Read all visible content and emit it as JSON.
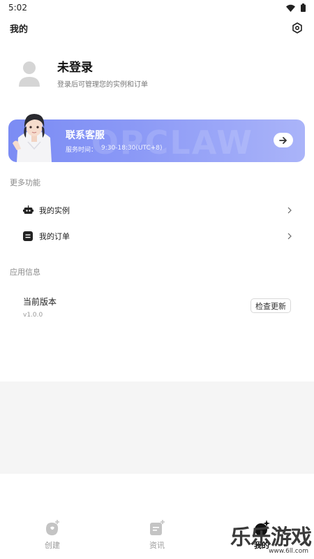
{
  "status": {
    "time": "5:02"
  },
  "header": {
    "title": "我的"
  },
  "profile": {
    "name": "未登录",
    "subtitle": "登录后可管理您的实例和订单"
  },
  "service": {
    "title": "联系客服",
    "hours_label": "服务时间：",
    "hours": "9:30-18:30(UTC+8)",
    "watermark": "OPCLAW"
  },
  "more": {
    "label": "更多功能",
    "items": [
      {
        "label": "我的实例",
        "icon": "robot-icon"
      },
      {
        "label": "我的订单",
        "icon": "order-icon"
      }
    ]
  },
  "app_info": {
    "label": "应用信息",
    "version_title": "当前版本",
    "version": "v1.0.0",
    "check_label": "检查更新"
  },
  "tabs": [
    {
      "label": "创建",
      "icon": "create-icon",
      "active": false
    },
    {
      "label": "资讯",
      "icon": "news-icon",
      "active": false
    },
    {
      "label": "我的",
      "icon": "profile-tab-icon",
      "active": true
    }
  ],
  "corner_watermark": {
    "text": "乐乐游戏",
    "url": "www.6ll.com"
  },
  "colors": {
    "card_start": "#7b8cf4",
    "card_end": "#aab4f9",
    "grey_bg": "#f5f5f5"
  }
}
